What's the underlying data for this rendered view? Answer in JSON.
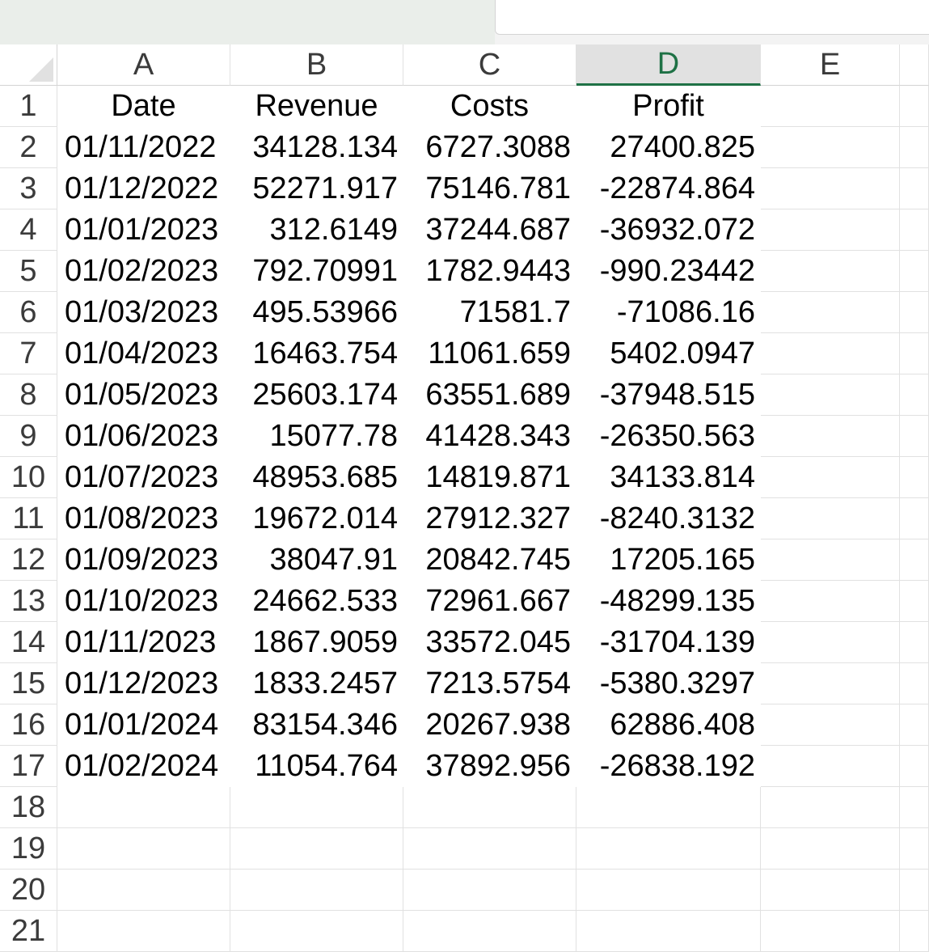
{
  "sheet": {
    "columns": [
      "A",
      "B",
      "C",
      "D",
      "E",
      ""
    ],
    "selected_column": "D",
    "row_numbers": [
      "1",
      "2",
      "3",
      "4",
      "5",
      "6",
      "7",
      "8",
      "9",
      "10",
      "11",
      "12",
      "13",
      "14",
      "15",
      "16",
      "17",
      "18",
      "19",
      "20",
      "21"
    ],
    "header_row": [
      "Date",
      "Revenue",
      "Costs",
      "Profit"
    ],
    "rows": [
      [
        "01/11/2022",
        "34128.134",
        "6727.3088",
        "27400.825"
      ],
      [
        "01/12/2022",
        "52271.917",
        "75146.781",
        "-22874.864"
      ],
      [
        "01/01/2023",
        "312.6149",
        "37244.687",
        "-36932.072"
      ],
      [
        "01/02/2023",
        "792.70991",
        "1782.9443",
        "-990.23442"
      ],
      [
        "01/03/2023",
        "495.53966",
        "71581.7",
        "-71086.16"
      ],
      [
        "01/04/2023",
        "16463.754",
        "11061.659",
        "5402.0947"
      ],
      [
        "01/05/2023",
        "25603.174",
        "63551.689",
        "-37948.515"
      ],
      [
        "01/06/2023",
        "15077.78",
        "41428.343",
        "-26350.563"
      ],
      [
        "01/07/2023",
        "48953.685",
        "14819.871",
        "34133.814"
      ],
      [
        "01/08/2023",
        "19672.014",
        "27912.327",
        "-8240.3132"
      ],
      [
        "01/09/2023",
        "38047.91",
        "20842.745",
        "17205.165"
      ],
      [
        "01/10/2023",
        "24662.533",
        "72961.667",
        "-48299.135"
      ],
      [
        "01/11/2023",
        "1867.9059",
        "33572.045",
        "-31704.139"
      ],
      [
        "01/12/2023",
        "1833.2457",
        "7213.5754",
        "-5380.3297"
      ],
      [
        "01/01/2024",
        "83154.346",
        "20267.938",
        "62886.408"
      ],
      [
        "01/02/2024",
        "11054.764",
        "37892.956",
        "-26838.192"
      ]
    ],
    "total_rows": 21,
    "colors": {
      "selected_header_bg": "#e1e1e1",
      "selected_header_text": "#1e7145",
      "gridline": "#e1e1e1"
    }
  }
}
